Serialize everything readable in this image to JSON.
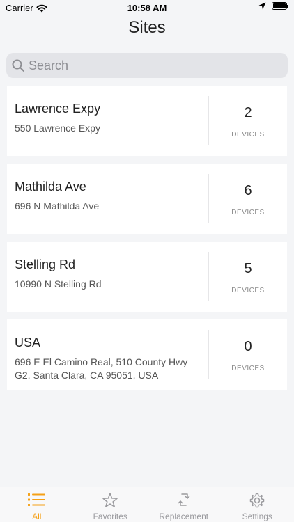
{
  "status_bar": {
    "carrier": "Carrier",
    "time": "10:58 AM"
  },
  "header": {
    "title": "Sites"
  },
  "search": {
    "placeholder": "Search"
  },
  "sites": [
    {
      "name": "Lawrence Expy",
      "address": "550 Lawrence Expy",
      "count": "2",
      "count_label": "DEVICES"
    },
    {
      "name": "Mathilda Ave",
      "address": "696 N Mathilda Ave",
      "count": "6",
      "count_label": "DEVICES"
    },
    {
      "name": "Stelling Rd",
      "address": "10990 N Stelling Rd",
      "count": "5",
      "count_label": "DEVICES"
    },
    {
      "name": "USA",
      "address": "696 E El Camino Real, 510 County Hwy G2, Santa Clara, CA 95051, USA",
      "count": "0",
      "count_label": "DEVICES"
    }
  ],
  "tabs": [
    {
      "label": "All",
      "icon": "list-icon",
      "active": true
    },
    {
      "label": "Favorites",
      "icon": "star-icon",
      "active": false
    },
    {
      "label": "Replacement",
      "icon": "replace-arrows-icon",
      "active": false
    },
    {
      "label": "Settings",
      "icon": "gear-icon",
      "active": false
    }
  ],
  "colors": {
    "accent": "#f5a016",
    "background": "#f4f5f7",
    "inactive_tab": "#9a9a9e"
  }
}
